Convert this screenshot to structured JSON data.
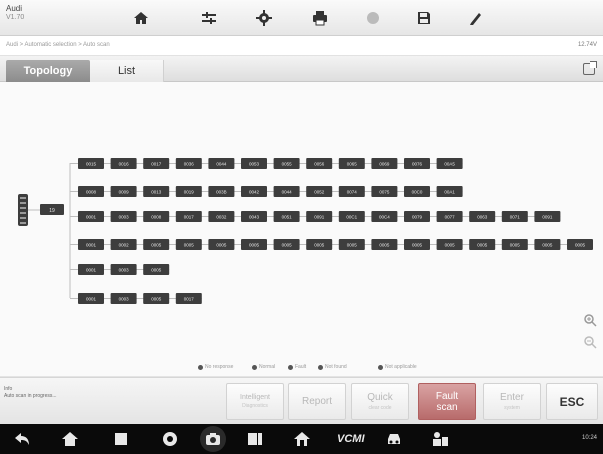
{
  "header": {
    "brand": "Audi",
    "version": "V1.70",
    "icons": [
      "home-icon",
      "vehicle-swap-icon",
      "settings-icon",
      "print-icon",
      "help-icon",
      "save-icon",
      "data-logging-icon"
    ]
  },
  "breadcrumb": {
    "text": "Audi > Automatic selection > Auto scan",
    "voltage": "12.74V"
  },
  "tabs": {
    "topology": "Topology",
    "list": "List"
  },
  "topology": {
    "gateway_label": "19",
    "rows": [
      [
        "0015",
        "0016",
        "0017",
        "0036",
        "0044",
        "0053",
        "0055",
        "0056",
        "0065",
        "0069",
        "0076",
        "00A5"
      ],
      [
        "0008",
        "0009",
        "0013",
        "0019",
        "003B",
        "0042",
        "0044",
        "0052",
        "0074",
        "0075",
        "00C0",
        "00A1"
      ],
      [
        "0001",
        "0003",
        "0008",
        "0017",
        "0032",
        "0043",
        "0051",
        "0091",
        "00C1",
        "00C4",
        "0079",
        "0077",
        "0063",
        "0071",
        "0091"
      ],
      [
        "0001",
        "0002",
        "0005",
        "0005",
        "0005",
        "0005",
        "0005",
        "0005",
        "0005",
        "0005",
        "0005",
        "0005",
        "0005",
        "0005",
        "0005",
        "0005"
      ],
      [
        "0001",
        "0003",
        "0005"
      ],
      [
        "0001",
        "0003",
        "0005",
        "0017"
      ]
    ],
    "colors": {
      "node": "#3d3d3d",
      "node_text": "#e8e8e8",
      "link": "#bdbdbd"
    }
  },
  "legend": [
    {
      "label": "No response",
      "color": "#555555"
    },
    {
      "label": "Normal",
      "color": "#555555"
    },
    {
      "label": "Fault",
      "color": "#555555"
    },
    {
      "label": "Not found",
      "color": "#555555"
    },
    {
      "label": "Not applicable",
      "color": "#555555"
    }
  ],
  "status": {
    "line1": "Info",
    "line2": "Auto scan in progress..."
  },
  "actions": {
    "intelligent": {
      "label": "Intelligent",
      "sub": "Diagnostics"
    },
    "report": {
      "label": "Report"
    },
    "quick": {
      "label": "Quick",
      "sub": "clear code"
    },
    "fault": {
      "label": "Fault",
      "sub": "scan"
    },
    "enter": {
      "label": "Enter",
      "sub": "system"
    },
    "esc": {
      "label": "ESC"
    }
  },
  "navbar": {
    "vcmi": "VCMI",
    "clock": "10:24"
  }
}
